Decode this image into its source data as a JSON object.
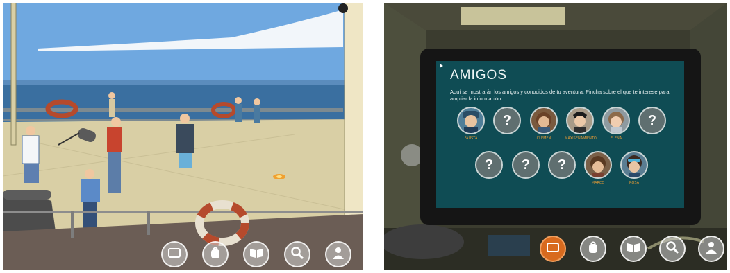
{
  "colors": {
    "sky": "#6fa8e0",
    "sea": "#3a6fa0",
    "deck": "#d9cfa5",
    "tablet_screen": "#0f4c54",
    "title_text": "#eef6f6",
    "name_text": "#e39a35",
    "active_button": "#d86a1e"
  },
  "left_panel": {
    "toolbar": [
      {
        "icon": "tablet-icon",
        "active": false
      },
      {
        "icon": "backpack-icon",
        "active": false
      },
      {
        "icon": "book-icon",
        "active": false
      },
      {
        "icon": "magnifier-icon",
        "active": false
      },
      {
        "icon": "user-icon",
        "active": false
      }
    ]
  },
  "right_panel": {
    "tablet": {
      "title": "AMIGOS",
      "description": "Aquí se mostrarán los amigos y conocidos de tu aventura. Pincha sobre el que te interese para ampliar la información.",
      "friends_row1": [
        {
          "known": true,
          "name": "FAUSTA"
        },
        {
          "known": false,
          "name": "",
          "label": "?"
        },
        {
          "known": true,
          "name": "CLEMEN"
        },
        {
          "known": true,
          "name": "MAXISEÑAMIENTO"
        },
        {
          "known": true,
          "name": "ELENA"
        },
        {
          "known": false,
          "name": "",
          "label": "?"
        }
      ],
      "friends_row2": [
        {
          "known": false,
          "name": "",
          "label": "?"
        },
        {
          "known": false,
          "name": "",
          "label": "?"
        },
        {
          "known": false,
          "name": "",
          "label": "?"
        },
        {
          "known": true,
          "name": "MARCO"
        },
        {
          "known": true,
          "name": "ROSA"
        }
      ]
    },
    "toolbar": [
      {
        "icon": "tablet-icon",
        "active": true
      },
      {
        "icon": "backpack-icon",
        "active": false
      },
      {
        "icon": "book-icon",
        "active": false
      },
      {
        "icon": "magnifier-icon",
        "active": false
      },
      {
        "icon": "user-icon",
        "active": false
      }
    ]
  }
}
